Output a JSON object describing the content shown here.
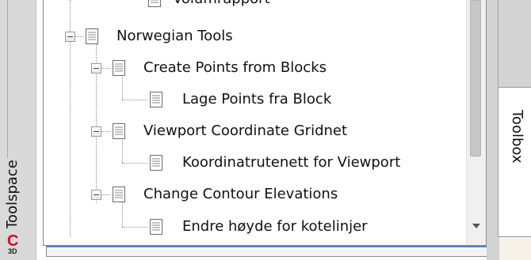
{
  "toolspace": {
    "title": "Toolspace"
  },
  "tabs": {
    "toolbox": "Toolbox"
  },
  "tree": {
    "items": [
      {
        "label": "Volumrapport",
        "level": 2
      },
      {
        "label": "Norwegian Tools",
        "level": 1
      },
      {
        "label": "Create Points from Blocks",
        "level": 2
      },
      {
        "label": "Lage Points fra Block",
        "level": 3
      },
      {
        "label": "Viewport Coordinate Gridnet",
        "level": 2
      },
      {
        "label": "Koordinatrutenett for Viewport",
        "level": 3
      },
      {
        "label": "Change Contour Elevations",
        "level": 2
      },
      {
        "label": "Endre høyde for kotelinjer",
        "level": 3
      }
    ]
  },
  "logo": {
    "letter": "C",
    "sub": "3D"
  },
  "colors": {
    "logo_red": "#c8102e",
    "selection_blue": "#5b7fb8"
  }
}
